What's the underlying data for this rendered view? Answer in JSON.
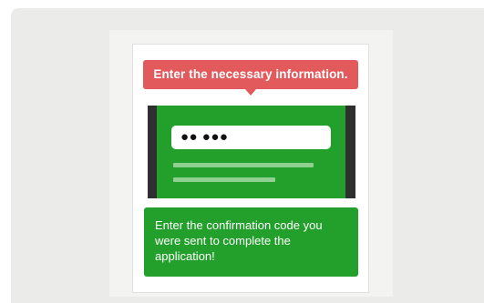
{
  "tooltip": {
    "text": "Enter the necessary information.",
    "color": "#e35a5d"
  },
  "screen": {
    "code_field_value": "●● ●●●",
    "accent_color": "#23a02b"
  },
  "message": {
    "text": "Enter the confirmation code you were sent to complete the application!"
  }
}
